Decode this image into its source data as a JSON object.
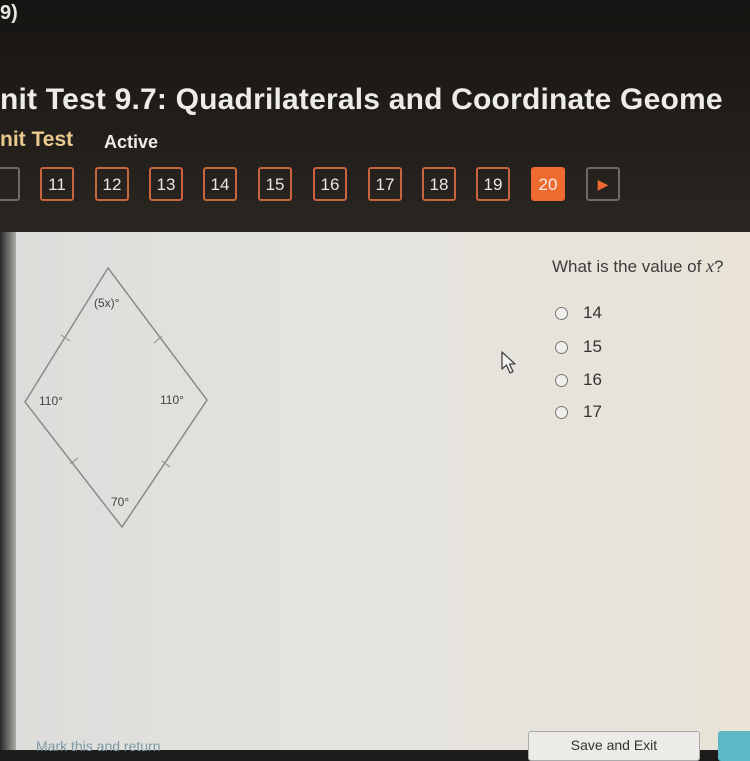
{
  "header": {
    "crumb": "9)",
    "title": "nit Test 9.7: Quadrilaterals and Coordinate Geome",
    "subtitle": "nit Test",
    "status": "Active"
  },
  "question_nav": {
    "items": [
      {
        "label": "",
        "state": "partial"
      },
      {
        "label": "11",
        "state": "normal"
      },
      {
        "label": "12",
        "state": "normal"
      },
      {
        "label": "13",
        "state": "normal"
      },
      {
        "label": "14",
        "state": "normal"
      },
      {
        "label": "15",
        "state": "normal"
      },
      {
        "label": "16",
        "state": "normal"
      },
      {
        "label": "17",
        "state": "normal"
      },
      {
        "label": "18",
        "state": "normal"
      },
      {
        "label": "19",
        "state": "normal"
      },
      {
        "label": "20",
        "state": "active"
      }
    ],
    "next_icon": "▶",
    "accent_color": "#ee6a2e"
  },
  "figure": {
    "shape": "rhombus",
    "angles": {
      "top": "(5x)°",
      "left": "110°",
      "right": "110°",
      "bottom": "70°"
    }
  },
  "question": {
    "prefix": "What is the value of ",
    "variable": "x",
    "suffix": "?",
    "options": [
      "14",
      "15",
      "16",
      "17"
    ]
  },
  "footer": {
    "mark_link": "Mark this and return",
    "save_exit": "Save and Exit",
    "next_color": "#5ab9c4"
  }
}
